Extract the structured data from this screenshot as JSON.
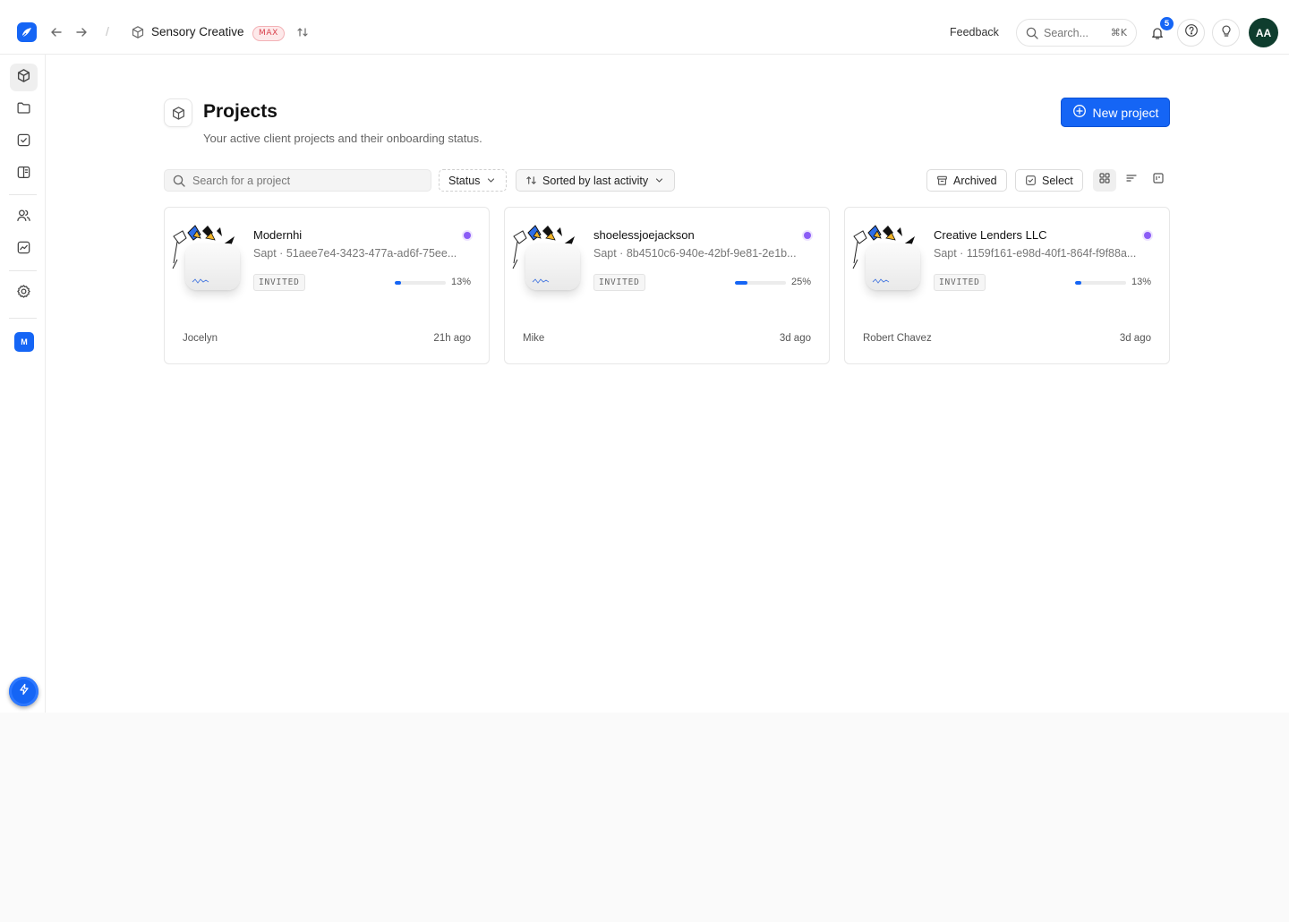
{
  "topbar": {
    "workspace_name": "Sensory Creative",
    "plan_badge": "MAX",
    "feedback_label": "Feedback",
    "search_placeholder": "Search...",
    "search_shortcut": "⌘K",
    "notification_count": "5",
    "avatar_initials": "AA"
  },
  "sidebar": {
    "items": [
      {
        "name": "projects",
        "icon": "box-icon",
        "active": true
      },
      {
        "name": "files",
        "icon": "folder-icon"
      },
      {
        "name": "tasks",
        "icon": "check-square-icon"
      },
      {
        "name": "forms",
        "icon": "book-icon"
      },
      {
        "name": "clients",
        "icon": "users-icon"
      },
      {
        "name": "analytics",
        "icon": "chart-icon"
      },
      {
        "name": "settings",
        "icon": "gear-icon"
      }
    ],
    "org_initial": "M"
  },
  "header": {
    "title": "Projects",
    "subtitle": "Your active client projects and their onboarding status.",
    "new_project_label": "New project"
  },
  "toolbar": {
    "search_placeholder": "Search for a project",
    "status_label": "Status",
    "sort_label": "Sorted by last activity",
    "archived_label": "Archived",
    "select_label": "Select"
  },
  "projects": [
    {
      "name": "Modernhi",
      "meta": "Sapt · 51aee7e4-3423-477a-ad6f-75ee...",
      "status": "INVITED",
      "progress_percent": 13,
      "progress_label": "13%",
      "owner": "Jocelyn",
      "last_activity": "21h ago"
    },
    {
      "name": "shoelessjoejackson",
      "meta": "Sapt · 8b4510c6-940e-42bf-9e81-2e1b...",
      "status": "INVITED",
      "progress_percent": 25,
      "progress_label": "25%",
      "owner": "Mike",
      "last_activity": "3d ago"
    },
    {
      "name": "Creative Lenders LLC",
      "meta": "Sapt · 1159f161-e98d-40f1-864f-f9f88a...",
      "status": "INVITED",
      "progress_percent": 13,
      "progress_label": "13%",
      "owner": "Robert Chavez",
      "last_activity": "3d ago"
    }
  ],
  "colors": {
    "accent": "#1565f5",
    "status_dot": "#8b5cf6",
    "plan_badge": "#d9424d",
    "avatar_bg": "#0f3d2e"
  }
}
